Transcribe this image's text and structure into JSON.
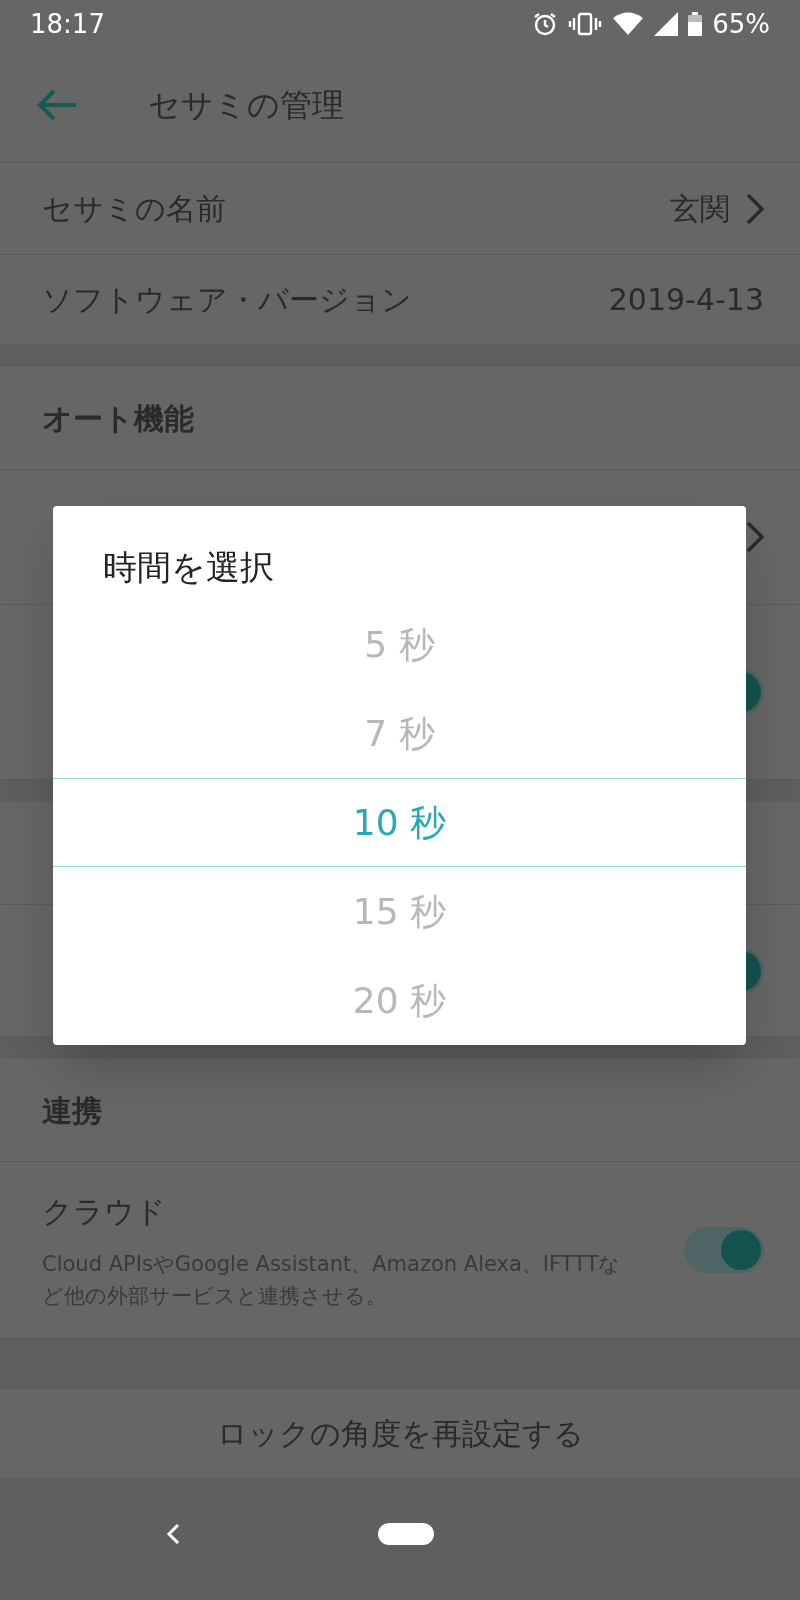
{
  "status_bar": {
    "time": "18:17",
    "battery": "65%"
  },
  "header": {
    "title": "セサミの管理"
  },
  "sections": [
    {
      "rows": [
        {
          "kind": "link",
          "label": "セサミの名前",
          "value": "玄関"
        },
        {
          "kind": "info",
          "label": "ソフトウェア・バージョン",
          "value": "2019-4-13"
        }
      ]
    },
    {
      "heading": "オート機能",
      "rows": [
        {
          "kind": "link"
        },
        {
          "kind": "toggle",
          "on": true
        }
      ]
    },
    {
      "rows": [
        {
          "kind": "toggle",
          "on": true
        }
      ]
    },
    {
      "heading": "連携",
      "rows": [
        {
          "kind": "toggle",
          "label": "クラウド",
          "description": "Cloud APIsやGoogle Assistant、Amazon Alexa、IFTTTなど他の外部サービスと連携させる。",
          "on": true
        }
      ]
    }
  ],
  "action_button": "ロックの角度を再設定する",
  "dialog": {
    "title": "時間を選択",
    "options": [
      {
        "label": "5 秒",
        "selected": false
      },
      {
        "label": "7 秒",
        "selected": false
      },
      {
        "label": "10 秒",
        "selected": true
      },
      {
        "label": "15 秒",
        "selected": false
      },
      {
        "label": "20 秒",
        "selected": false
      }
    ]
  }
}
